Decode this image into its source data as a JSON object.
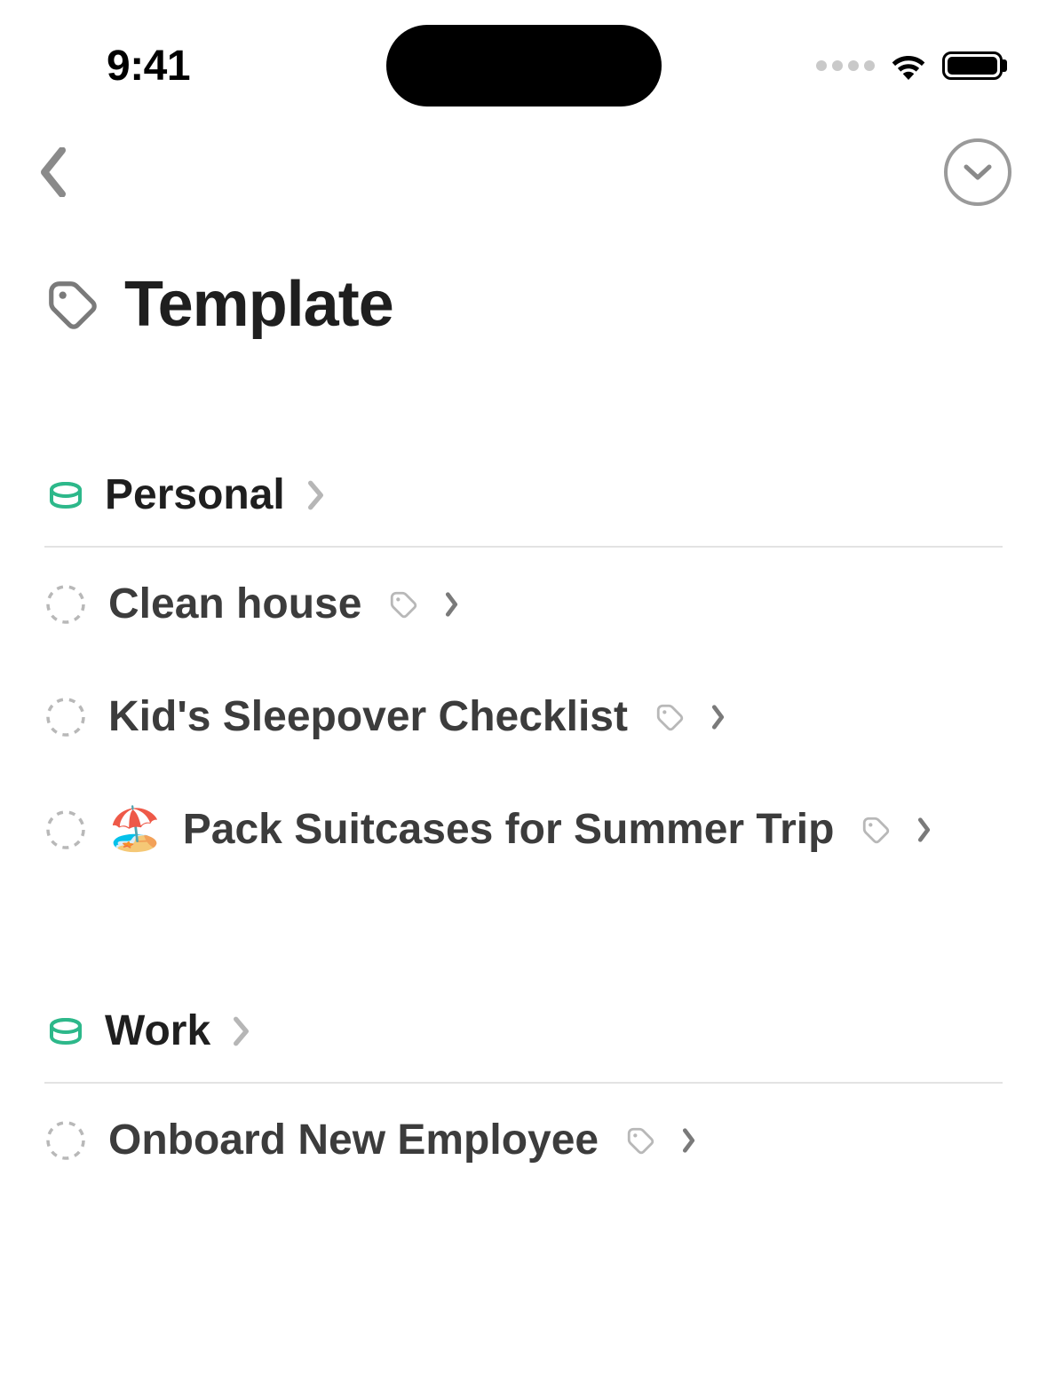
{
  "status": {
    "time": "9:41"
  },
  "page": {
    "title": "Template"
  },
  "sections": [
    {
      "title": "Personal",
      "items": [
        {
          "emoji": "",
          "title": "Clean house"
        },
        {
          "emoji": "",
          "title": "Kid's Sleepover Checklist"
        },
        {
          "emoji": "🏖️",
          "title": "Pack Suitcases for Summer Trip"
        }
      ]
    },
    {
      "title": "Work",
      "items": [
        {
          "emoji": "",
          "title": "Onboard New Employee"
        }
      ]
    }
  ]
}
